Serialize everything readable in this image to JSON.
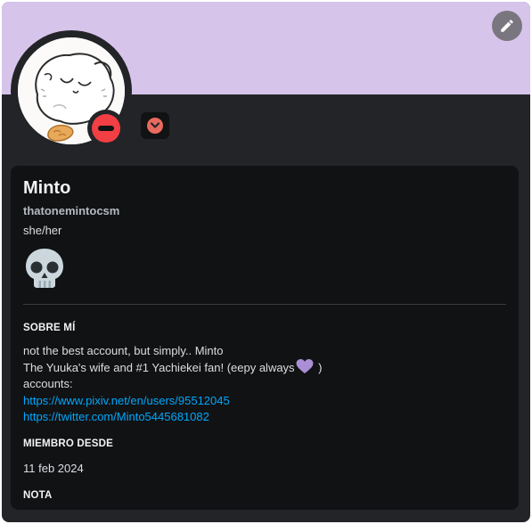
{
  "profile": {
    "display_name": "Minto",
    "username": "thatonemintocsm",
    "pronouns": "she/her",
    "status": "do-not-disturb",
    "custom_emoji": "skull",
    "banner_color": "#d6c4eb"
  },
  "about": {
    "heading": "SOBRE MÍ",
    "line1": "not the best account, but simply.. Minto",
    "line2_before": "The Yuuka's wife and #1 Yachiekei fan! (eepy always",
    "line2_after": " )",
    "line3": "accounts:",
    "link1": "https://www.pixiv.net/en/users/95512045",
    "link2": "https://twitter.com/Minto5445681082"
  },
  "member_since": {
    "heading": "MIEMBRO DESDE",
    "date": "11 feb 2024"
  },
  "note": {
    "heading": "NOTA"
  },
  "icons": {
    "edit": "pencil-icon",
    "status": "do-not-disturb-icon",
    "badge": "chevron-down-icon",
    "heart": "purple-heart-icon",
    "skull": "skull-icon"
  }
}
